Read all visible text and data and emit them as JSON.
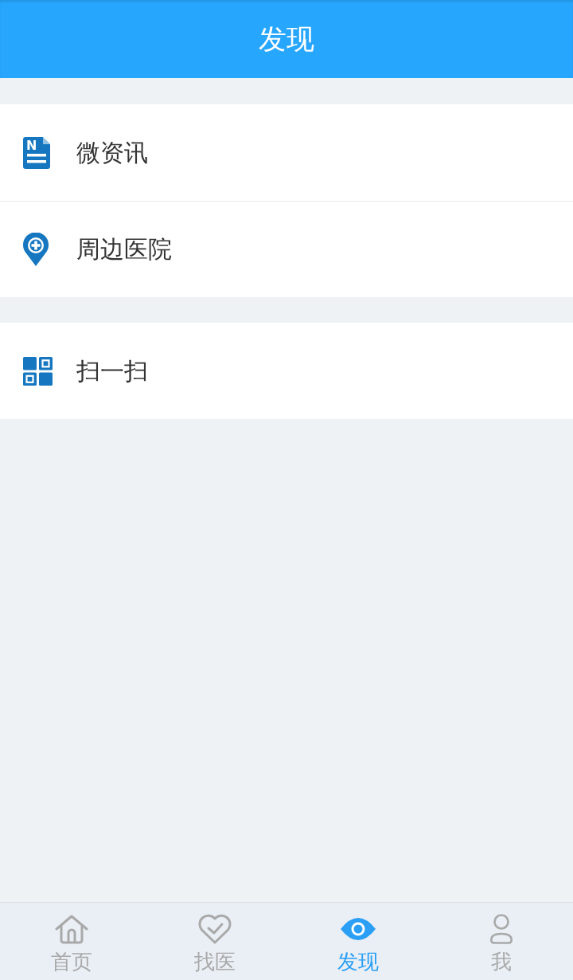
{
  "header": {
    "title": "发现"
  },
  "menu_groups": [
    {
      "items": [
        {
          "kind": "news",
          "icon_letter": "N",
          "label": "微资讯"
        },
        {
          "kind": "location",
          "label": "周边医院"
        }
      ]
    },
    {
      "items": [
        {
          "kind": "grid",
          "label": "扫一扫"
        }
      ]
    }
  ],
  "tabs": [
    {
      "kind": "home",
      "label": "首页",
      "selected": false
    },
    {
      "kind": "heart",
      "label": "找医",
      "selected": false
    },
    {
      "kind": "eye",
      "label": "发现",
      "selected": true
    },
    {
      "kind": "person",
      "label": "我",
      "selected": false
    }
  ]
}
